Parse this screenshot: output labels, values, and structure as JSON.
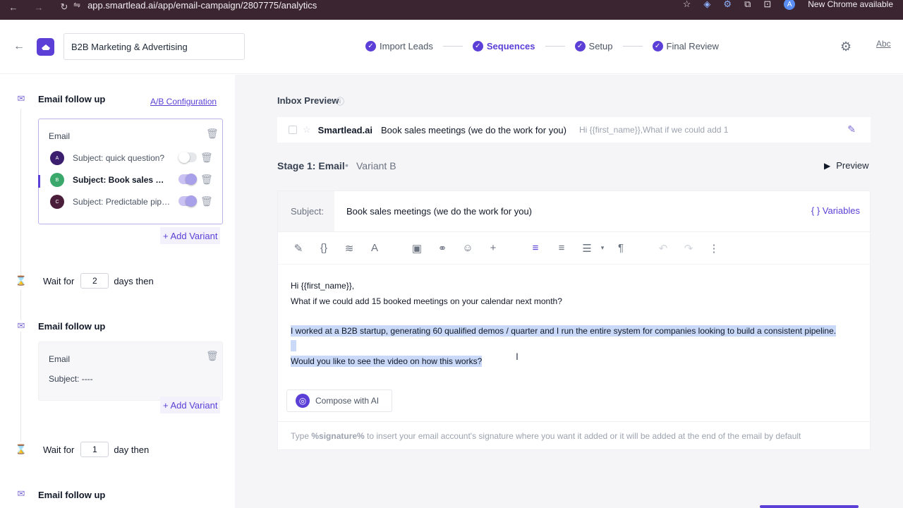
{
  "browser": {
    "url": "app.smartlead.ai/app/email-campaign/2807775/analytics",
    "update_label": "New Chrome available",
    "profile_initial": "A"
  },
  "header": {
    "campaign_name": "B2B Marketing & Advertising",
    "steps": [
      {
        "label": "Import Leads",
        "active": false
      },
      {
        "label": "Sequences",
        "active": true
      },
      {
        "label": "Setup",
        "active": false
      },
      {
        "label": "Final Review",
        "active": false
      }
    ],
    "abc_label": "Abc"
  },
  "sidebar": {
    "step1": {
      "title": "Email follow up",
      "ab_link": "A/B Configuration",
      "card_label": "Email",
      "variants": [
        {
          "badge": "A",
          "subject": "Subject: quick question?",
          "enabled": false,
          "color": "#3b1f6e"
        },
        {
          "badge": "B",
          "subject": "Subject: Book sales meetings (we do the work for you)",
          "enabled": true,
          "color": "#3aa86b"
        },
        {
          "badge": "C",
          "subject": "Subject: Predictable pipeline",
          "enabled": true,
          "color": "#4a1d3a"
        }
      ],
      "add_variant": "+ Add Variant"
    },
    "wait1": {
      "prefix": "Wait for",
      "value": "2",
      "suffix": "days then"
    },
    "step2": {
      "title": "Email follow up",
      "card_label": "Email",
      "subject": "Subject: ----",
      "add_variant": "+ Add Variant"
    },
    "wait2": {
      "prefix": "Wait for",
      "value": "1",
      "suffix": "day then"
    },
    "step3": {
      "title": "Email follow up"
    }
  },
  "inbox_preview": {
    "title": "Inbox Preview",
    "sender": "Smartlead.ai",
    "subject": "Book sales meetings (we do the work for you)",
    "snippet": "Hi {{first_name}},What if we could add 1"
  },
  "stage": {
    "title": "Stage 1: Email",
    "variant": "Variant B",
    "preview_label": "Preview"
  },
  "editor": {
    "subject_label": "Subject:",
    "subject_value": "Book sales meetings (we do the work for you)",
    "variables_label": "{ } Variables",
    "body_lines": [
      "Hi {{first_name}},",
      "What if we could add 15 booked meetings on your calendar next month?",
      "I worked at a B2B startup, generating 60 qualified demos / quarter and I run the entire system for companies looking to build a consistent pipeline.",
      "Would you like to see the video on how this works?"
    ],
    "compose_label": "Compose with AI",
    "signature_pre": "Type ",
    "signature_token": "%signature%",
    "signature_post": " to insert your email account's signature where you want it added or it will be added at the end of the email by default"
  },
  "colors": {
    "accent": "#5b3fd6",
    "highlight": "#c9d9f7"
  }
}
